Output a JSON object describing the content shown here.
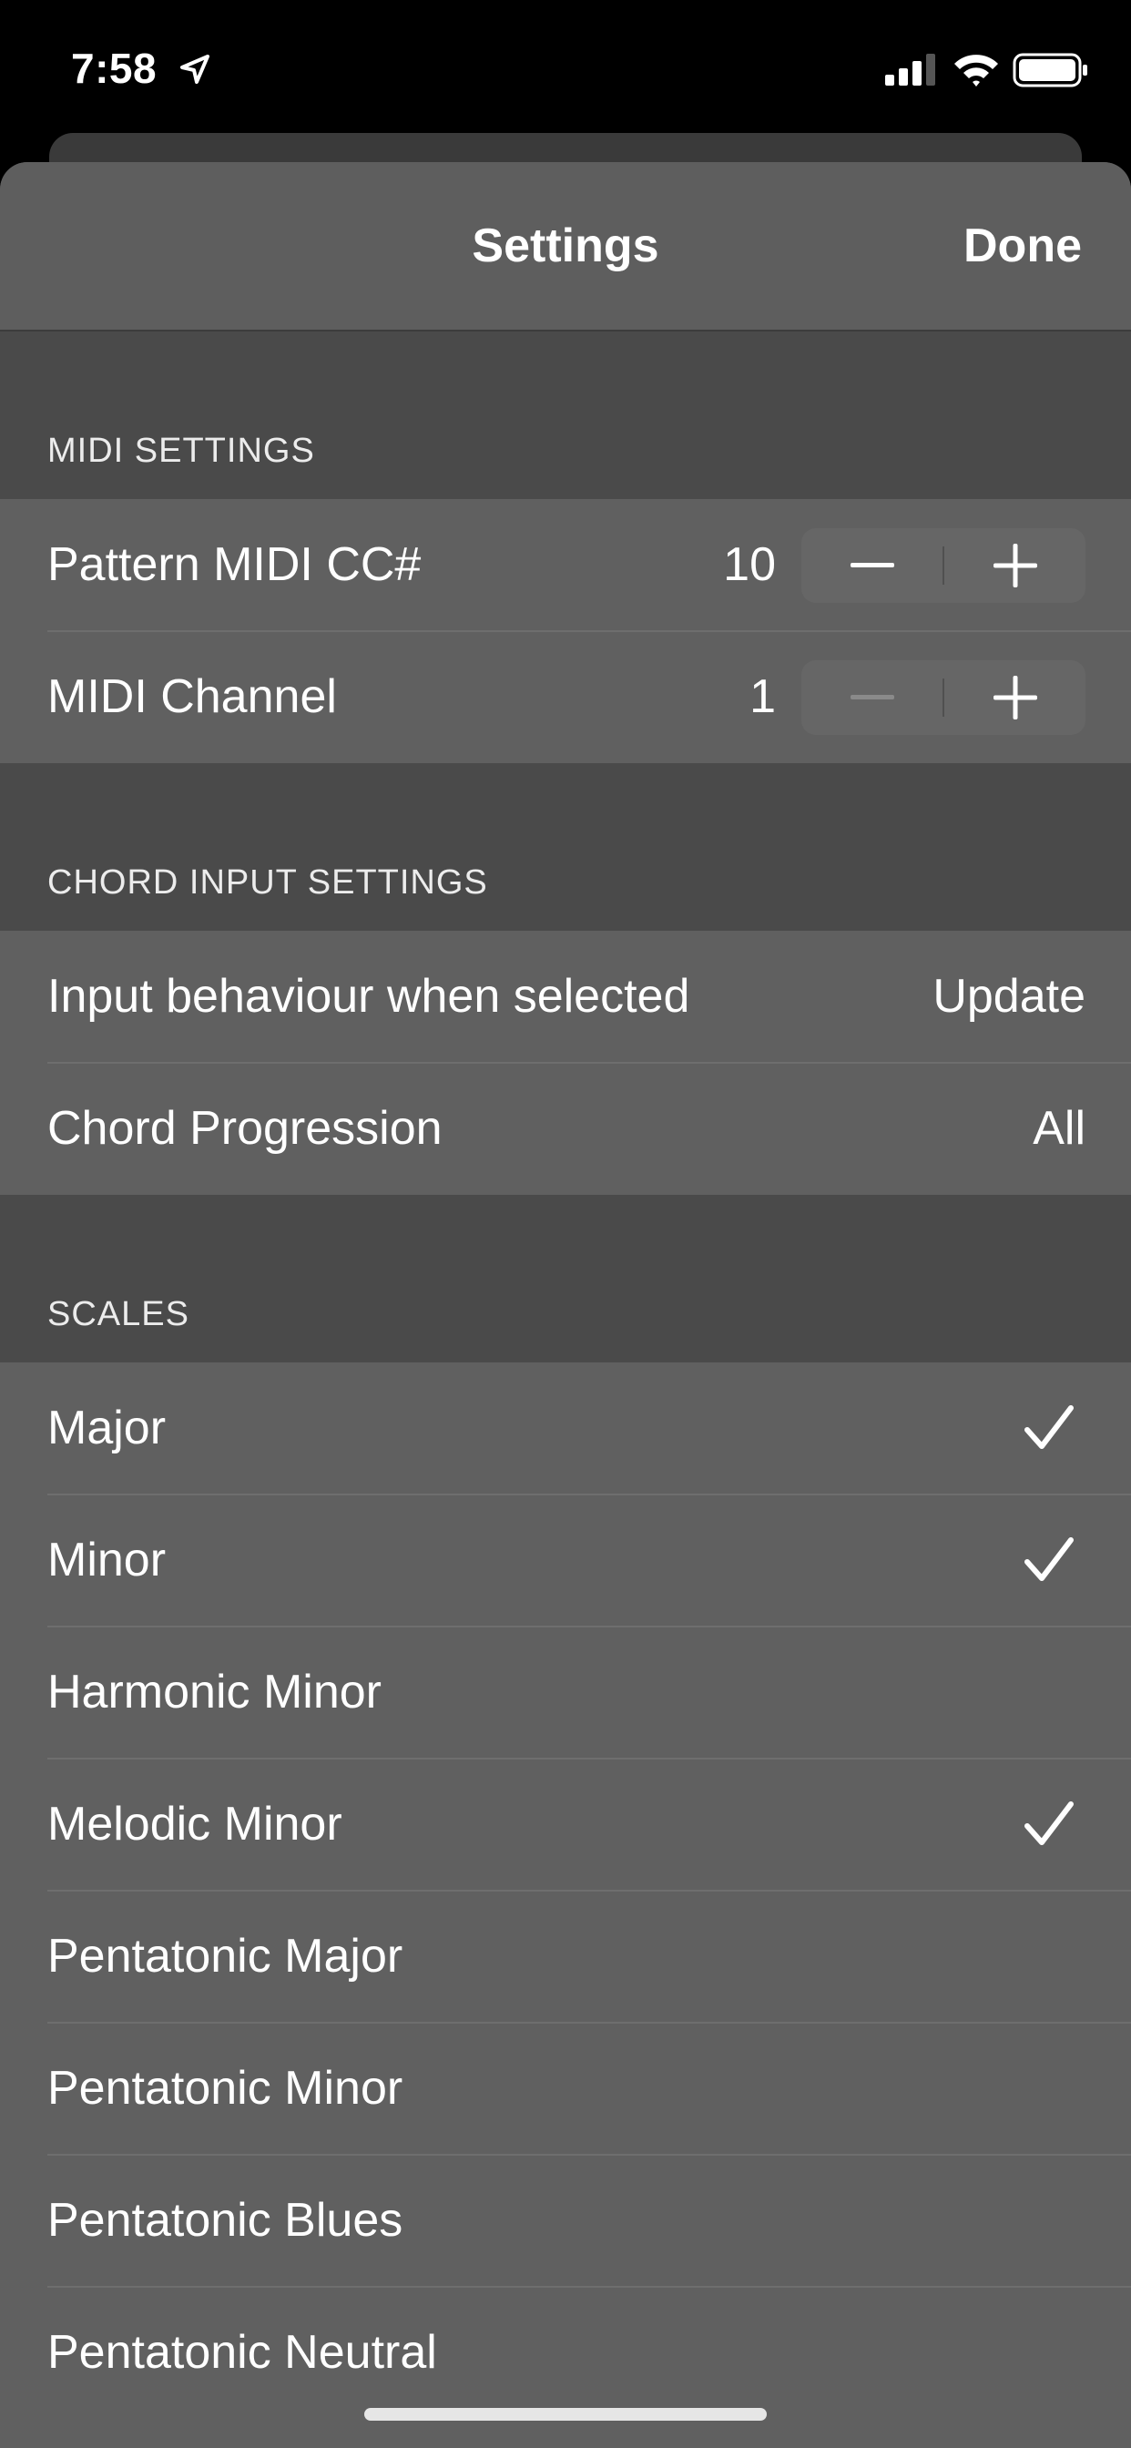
{
  "status_bar": {
    "time": "7:58"
  },
  "nav": {
    "title": "Settings",
    "done_label": "Done"
  },
  "midi": {
    "header": "MIDI SETTINGS",
    "rows": [
      {
        "label": "Pattern MIDI CC#",
        "value": "10"
      },
      {
        "label": "MIDI Channel",
        "value": "1"
      }
    ]
  },
  "chord": {
    "header": "CHORD INPUT SETTINGS",
    "rows": [
      {
        "label": "Input behaviour when selected",
        "value": "Update"
      },
      {
        "label": "Chord Progression",
        "value": "All"
      }
    ]
  },
  "scales": {
    "header": "SCALES",
    "items": [
      {
        "label": "Major",
        "checked": true
      },
      {
        "label": "Minor",
        "checked": true
      },
      {
        "label": "Harmonic Minor",
        "checked": false
      },
      {
        "label": "Melodic Minor",
        "checked": true
      },
      {
        "label": "Pentatonic Major",
        "checked": false
      },
      {
        "label": "Pentatonic Minor",
        "checked": false
      },
      {
        "label": "Pentatonic Blues",
        "checked": false
      },
      {
        "label": "Pentatonic Neutral",
        "checked": false
      }
    ]
  },
  "colors": {
    "background": "#000000",
    "sheet": "#4a4a4a",
    "row": "#606060",
    "text": "#ffffff"
  }
}
